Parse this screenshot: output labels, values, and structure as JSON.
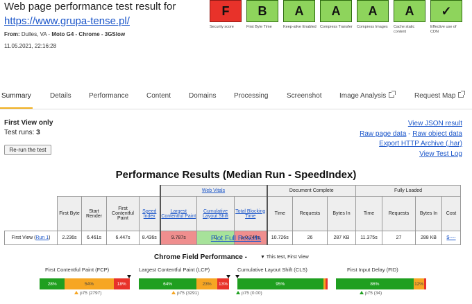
{
  "header": {
    "title": "Web page performance test result for",
    "url": "https://www.grupa-tense.pl/",
    "from_prefix": "From: ",
    "from_location": "Dulles, VA",
    "from_device": "Moto G4 - Chrome - 3GSlow",
    "date": "11.05.2021, 22:16:28"
  },
  "grades": [
    {
      "value": "F",
      "label": "Security score",
      "status": "fail"
    },
    {
      "value": "B",
      "label": "First Byte Time",
      "status": "pass"
    },
    {
      "value": "A",
      "label": "Keep-alive Enabled",
      "status": "pass"
    },
    {
      "value": "A",
      "label": "Compress Transfer",
      "status": "pass"
    },
    {
      "value": "A",
      "label": "Compress Images",
      "status": "pass"
    },
    {
      "value": "A",
      "label": "Cache static content",
      "status": "pass"
    },
    {
      "value": "✓",
      "label": "Effective use of CDN",
      "status": "pass"
    }
  ],
  "tabs": [
    "Summary",
    "Details",
    "Performance",
    "Content",
    "Domains",
    "Processing",
    "Screenshot",
    "Image Analysis",
    "Request Map"
  ],
  "run_info": {
    "view": "First View only",
    "test_runs_label": "Test runs:",
    "test_runs_value": "3",
    "rerun": "Re-run the test"
  },
  "links": {
    "json": "View JSON result",
    "raw_page": "Raw page data",
    "sep": " - ",
    "raw_object": "Raw object data",
    "har": "Export HTTP Archive (.har)",
    "log": "View Test Log"
  },
  "results": {
    "title": "Performance Results (Median Run - SpeedIndex)",
    "groups": {
      "web_vitals": "Web Vitals",
      "document": "Document Complete",
      "fully": "Fully Loaded"
    },
    "headers": {
      "first_byte": "First Byte",
      "start_render": "Start Render",
      "fcp": "First Contentful Paint",
      "speed_index": "Speed Index",
      "lcp": "Largest Contentful Paint",
      "cls": "Cumulative Layout Shift",
      "tbt": "Total Blocking Time",
      "time": "Time",
      "requests": "Requests",
      "bytes_in": "Bytes In",
      "cost": "Cost"
    },
    "row": {
      "label": "First View (",
      "run_link": "Run 1",
      "label_end": ")",
      "first_byte": "2.236s",
      "start_render": "6.461s",
      "fcp": "6.447s",
      "speed_index": "8.436s",
      "lcp": "9.787s",
      "cls": "0",
      "tbt": "≥ 0.744s",
      "doc_time": "10.726s",
      "doc_requests": "26",
      "doc_bytes": "287 KB",
      "full_time": "11.375s",
      "full_requests": "27",
      "full_bytes": "288 KB",
      "cost": "$----"
    },
    "plot_link": "Plot Full Results"
  },
  "field": {
    "title": "Chrome Field Performance -",
    "subtitle": "▼ This test, First View",
    "metrics": [
      {
        "label": "First Contentful Paint (FCP)",
        "good": 28,
        "mid": 54,
        "poor": 18,
        "good_label": "28%",
        "mid_label": "54%",
        "poor_label": "18%",
        "p75": "p75 (2797)"
      },
      {
        "label": "Largest Contentful Paint (LCP)",
        "good": 64,
        "mid": 23,
        "poor": 13,
        "good_label": "64%",
        "mid_label": "23%",
        "poor_label": "13%",
        "p75": "p75 (3291)"
      },
      {
        "label": "Cumulative Layout Shift (CLS)",
        "good": 95,
        "mid": 3,
        "poor": 2,
        "good_label": "95%",
        "mid_label": "",
        "poor_label": "",
        "p75": "p75 (0.00)"
      },
      {
        "label": "First Input Delay (FID)",
        "good": 86,
        "mid": 12,
        "poor": 2,
        "good_label": "86%",
        "mid_label": "12%",
        "poor_label": "",
        "p75": "p75 (34)"
      }
    ]
  },
  "colors": {
    "good": "#1f9f20",
    "mid": "#f6a623",
    "poor": "#e8322a",
    "link": "#1a55c9",
    "accent": "#f2b01e"
  }
}
